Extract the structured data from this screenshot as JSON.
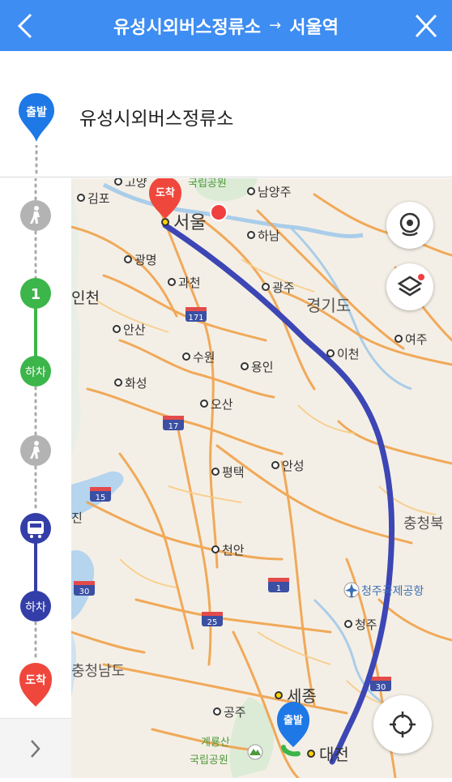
{
  "header": {
    "origin": "유성시외버스정류소",
    "arrow": "→",
    "destination": "서울역"
  },
  "origin_row": {
    "marker_label": "출발",
    "name": "유성시외버스정류소"
  },
  "timeline": {
    "subway_line": "1",
    "subway_get_off": "하차",
    "bus_get_off": "하차",
    "arrive": "도착"
  },
  "map": {
    "arrive_marker": "도착",
    "depart_marker": "출발",
    "cities": {
      "seoul": "서울",
      "gimpo": "김포",
      "goyang": "고양",
      "gwangmyeong": "광명",
      "gwacheon": "과천",
      "incheon": "인천",
      "ansan": "안산",
      "suwon": "수원",
      "yongin": "용인",
      "hwaseong": "화성",
      "osan": "오산",
      "pyeongtaek": "평택",
      "anseong": "안성",
      "cheonan": "천안",
      "namyangju": "남양주",
      "hanam": "하남",
      "gwangju": "광주",
      "icheon": "이천",
      "yeoju": "여주",
      "cheongju": "청주",
      "sejong": "세종",
      "gongju": "공주",
      "daejeon": "대전",
      "jin": "진"
    },
    "regions": {
      "gyeonggi": "경기도",
      "chungbuk": "충청북",
      "chungnam": "충청남도"
    },
    "parks": {
      "national_park": "국립공원",
      "gyeryongsan": "계룡산",
      "gyeryong_park": "국립공원"
    },
    "airport": "청주국제공항",
    "highways": {
      "h171": "171",
      "h17": "17",
      "h15": "15",
      "h30a": "30",
      "h25": "25",
      "h1": "1",
      "h30b": "30"
    }
  },
  "colors": {
    "header": "#3d8df2",
    "route": "#3c46b4",
    "subway": "#3cb54a",
    "walk": "#b3b3b3",
    "bus": "#343ea8",
    "start": "#1e78e6",
    "arrive": "#f0473c"
  }
}
